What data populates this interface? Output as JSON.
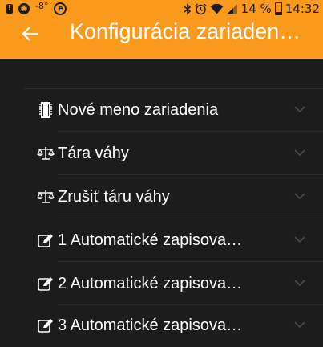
{
  "status_bar": {
    "temperature": "-8°",
    "battery_percent": "14 %",
    "time": "14:32",
    "left_icons": [
      "notification-icon",
      "camera-icon",
      "e-icon"
    ],
    "right_icons": [
      "bluetooth-icon",
      "alarm-icon",
      "wifi-icon",
      "signal-icon",
      "battery-icon"
    ]
  },
  "app_bar": {
    "title": "Konfigurácia zariaden…",
    "back_icon": "arrow-left-icon",
    "background": "#f99a1c"
  },
  "menu": {
    "items": [
      {
        "label": "Nové meno zariadenia",
        "icon": "sd-card-icon"
      },
      {
        "label": "Tára váhy",
        "icon": "scale-icon"
      },
      {
        "label": "Zrušiť táru váhy",
        "icon": "scale-icon"
      },
      {
        "label": "1 Automatické zapisova…",
        "icon": "edit-icon"
      },
      {
        "label": "2 Automatické zapisova…",
        "icon": "edit-icon"
      },
      {
        "label": "3 Automatické zapisova…",
        "icon": "edit-icon"
      }
    ],
    "chevron_icon": "chevron-down-icon"
  },
  "colors": {
    "background": "#1c1c1c",
    "accent": "#f99a1c",
    "divider": "#2f2f2f"
  }
}
